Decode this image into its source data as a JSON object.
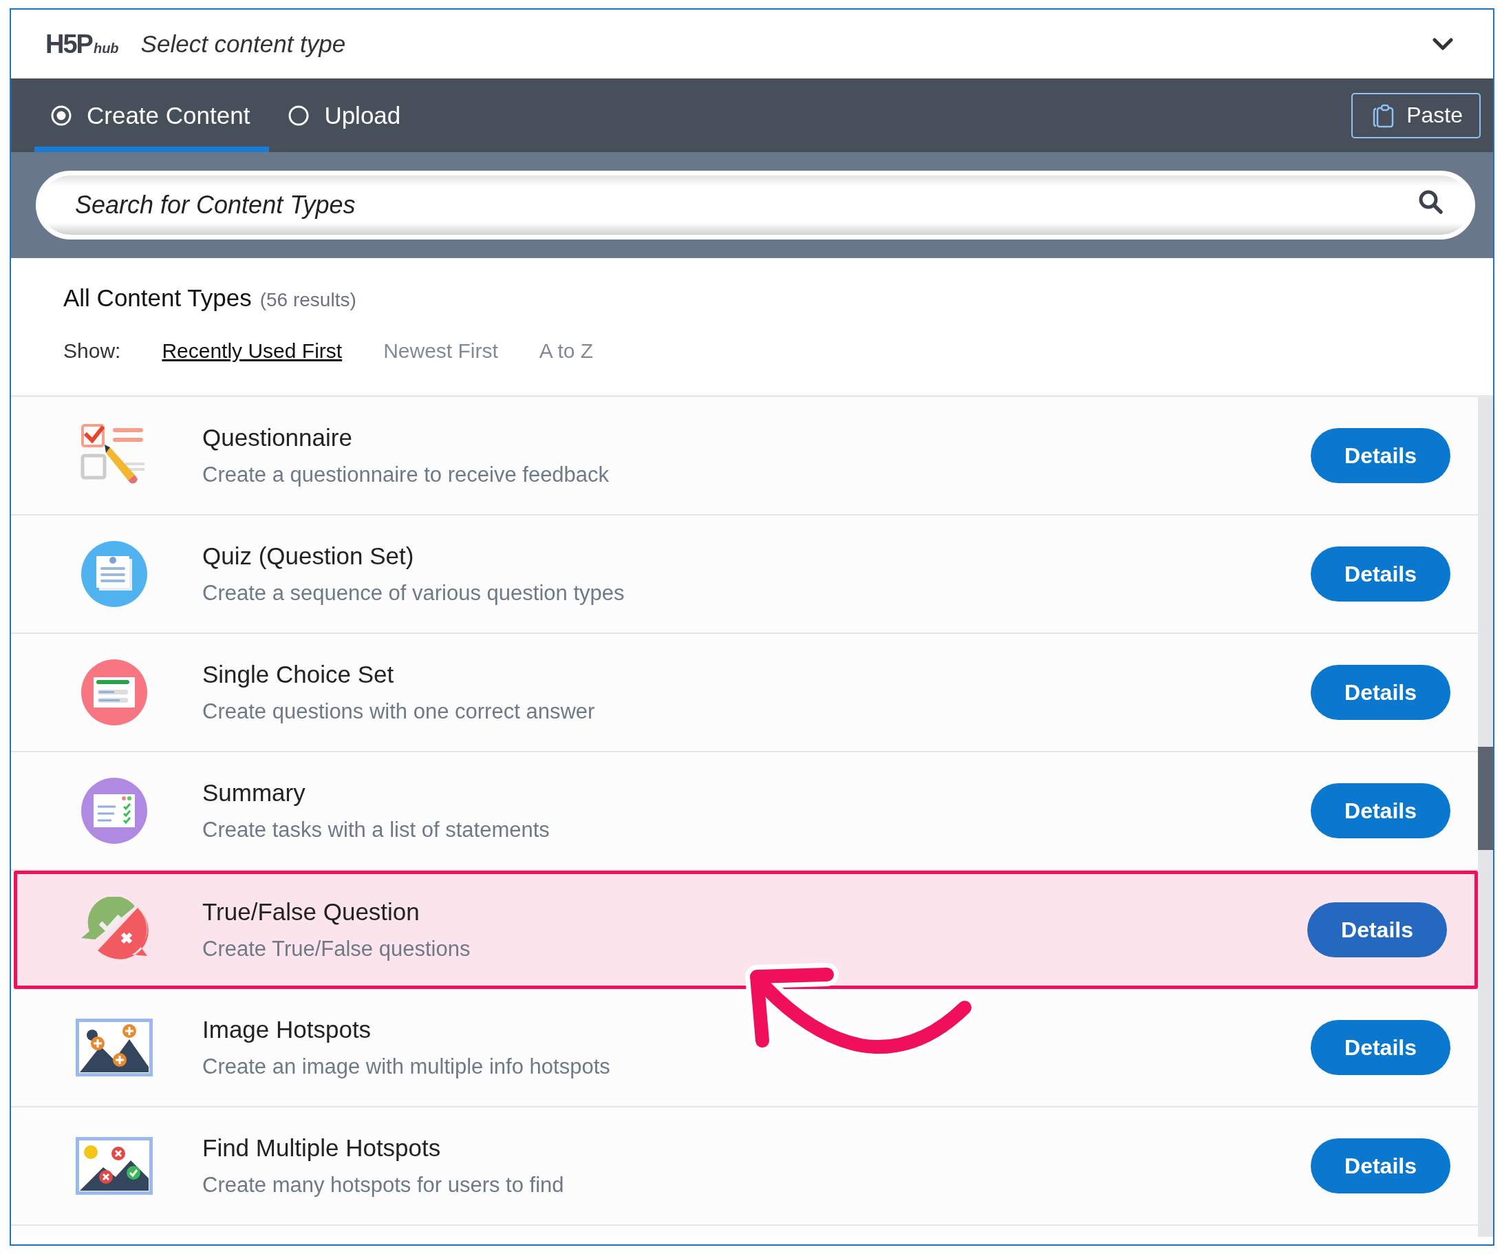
{
  "header": {
    "logo_text": "H5P",
    "logo_suffix": "hub",
    "title": "Select content type"
  },
  "tabs": [
    {
      "label": "Create Content",
      "selected": true
    },
    {
      "label": "Upload",
      "selected": false
    }
  ],
  "paste_button": "Paste",
  "search": {
    "placeholder": "Search for Content Types"
  },
  "results": {
    "heading": "All Content Types",
    "count": "(56 results)"
  },
  "sort": {
    "label": "Show:",
    "options": [
      {
        "label": "Recently Used First",
        "selected": true
      },
      {
        "label": "Newest First",
        "selected": false
      },
      {
        "label": "A to Z",
        "selected": false
      }
    ]
  },
  "items": [
    {
      "title": "Questionnaire",
      "description": "Create a questionnaire to receive feedback",
      "button": "Details",
      "highlighted": false
    },
    {
      "title": "Quiz (Question Set)",
      "description": "Create a sequence of various question types",
      "button": "Details",
      "highlighted": false
    },
    {
      "title": "Single Choice Set",
      "description": "Create questions with one correct answer",
      "button": "Details",
      "highlighted": false
    },
    {
      "title": "Summary",
      "description": "Create tasks with a list of statements",
      "button": "Details",
      "highlighted": false
    },
    {
      "title": "True/False Question",
      "description": "Create True/False questions",
      "button": "Details",
      "highlighted": true
    },
    {
      "title": "Image Hotspots",
      "description": "Create an image with multiple info hotspots",
      "button": "Details",
      "highlighted": false
    },
    {
      "title": "Find Multiple Hotspots",
      "description": "Create many hotspots for users to find",
      "button": "Details",
      "highlighted": false
    }
  ]
}
